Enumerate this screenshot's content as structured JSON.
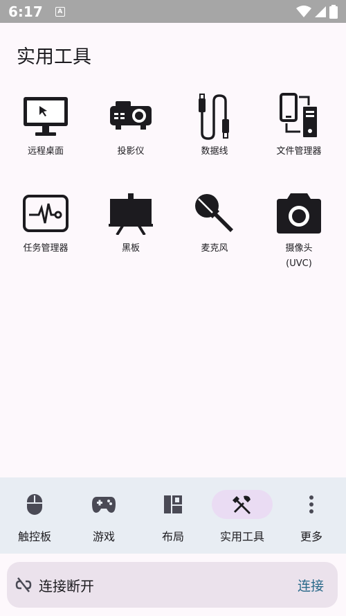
{
  "status_bar": {
    "time": "6:17",
    "badge": "A"
  },
  "page_title": "实用工具",
  "tools": [
    {
      "label": "远程桌面",
      "icon": "monitor-icon"
    },
    {
      "label": "投影仪",
      "icon": "projector-icon"
    },
    {
      "label": "数据线",
      "icon": "usb-cable-icon"
    },
    {
      "label": "文件管理器",
      "icon": "file-transfer-icon"
    },
    {
      "label": "任务管理器",
      "icon": "task-monitor-icon"
    },
    {
      "label": "黑板",
      "icon": "blackboard-icon"
    },
    {
      "label": "麦克风",
      "icon": "microphone-icon"
    },
    {
      "label": "摄像头\n(UVC)",
      "label_line1": "摄像头",
      "label_line2": "(UVC)",
      "icon": "camera-icon"
    }
  ],
  "bottom_nav": [
    {
      "label": "触控板",
      "icon": "mouse-icon"
    },
    {
      "label": "游戏",
      "icon": "gamepad-icon"
    },
    {
      "label": "布局",
      "icon": "layout-icon"
    },
    {
      "label": "实用工具",
      "icon": "tools-icon",
      "active": true
    },
    {
      "label": "更多",
      "icon": "more-vert-icon"
    }
  ],
  "connection": {
    "status": "连接断开",
    "action": "连接",
    "icon": "link-off-icon"
  }
}
